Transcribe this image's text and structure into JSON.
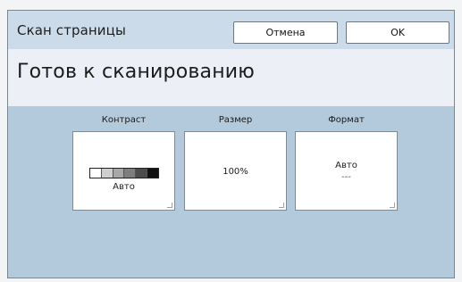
{
  "header": {
    "title": "Скан страницы",
    "cancel_label": "Отмена",
    "ok_label": "OK"
  },
  "status": {
    "text": "Готов к сканированию"
  },
  "settings": {
    "contrast": {
      "label": "Контраст",
      "value": "Авто",
      "scale_colors": [
        "#ffffff",
        "#cfcfcf",
        "#a7a7a7",
        "#7e7e7e",
        "#4c4c4c",
        "#111111"
      ]
    },
    "size": {
      "label": "Размер",
      "value": "100%"
    },
    "format": {
      "label": "Формат",
      "value": "Авто",
      "subvalue": "---"
    }
  },
  "colors": {
    "header_bg": "#ccdbe9",
    "status_bg": "#ecf0f6",
    "panel_bg": "#b3c9dc"
  }
}
